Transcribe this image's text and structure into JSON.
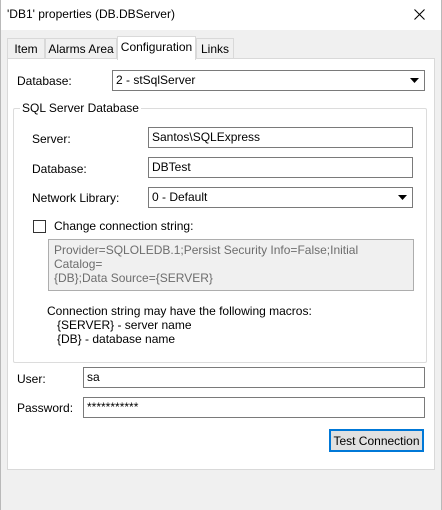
{
  "window": {
    "title": "'DB1' properties (DB.DBServer)",
    "close_icon": "close-icon"
  },
  "tabs": [
    {
      "label": "Item",
      "active": false
    },
    {
      "label": "Alarms Area",
      "active": false
    },
    {
      "label": "Configuration",
      "active": true
    },
    {
      "label": "Links",
      "active": false
    }
  ],
  "database": {
    "label": "Database:",
    "selected": "2 - stSqlServer"
  },
  "sql_group": {
    "title": "SQL Server Database",
    "server_label": "Server:",
    "server_value": "Santos\\SQLExpress",
    "database_label": "Database:",
    "database_value": "DBTest",
    "network_label": "Network Library:",
    "network_selected": "0 - Default",
    "change_conn_label": "Change connection string:",
    "change_conn_checked": false,
    "conn_string_line1": "Provider=SQLOLEDB.1;Persist Security Info=False;Initial Catalog=",
    "conn_string_line2": "{DB};Data Source={SERVER}",
    "macros_intro": "Connection string may have the following macros:",
    "macro_server": "{SERVER} - server name",
    "macro_db": "{DB} - database name"
  },
  "user": {
    "label": "User:",
    "value": "sa"
  },
  "password": {
    "label": "Password:",
    "value": "***********"
  },
  "test_connection": {
    "label": "Test Connection"
  },
  "colors": {
    "panel_bg": "#ffffff",
    "window_bg": "#f0f0f0",
    "border": "#7a7a7a",
    "focus": "#0078d7"
  }
}
